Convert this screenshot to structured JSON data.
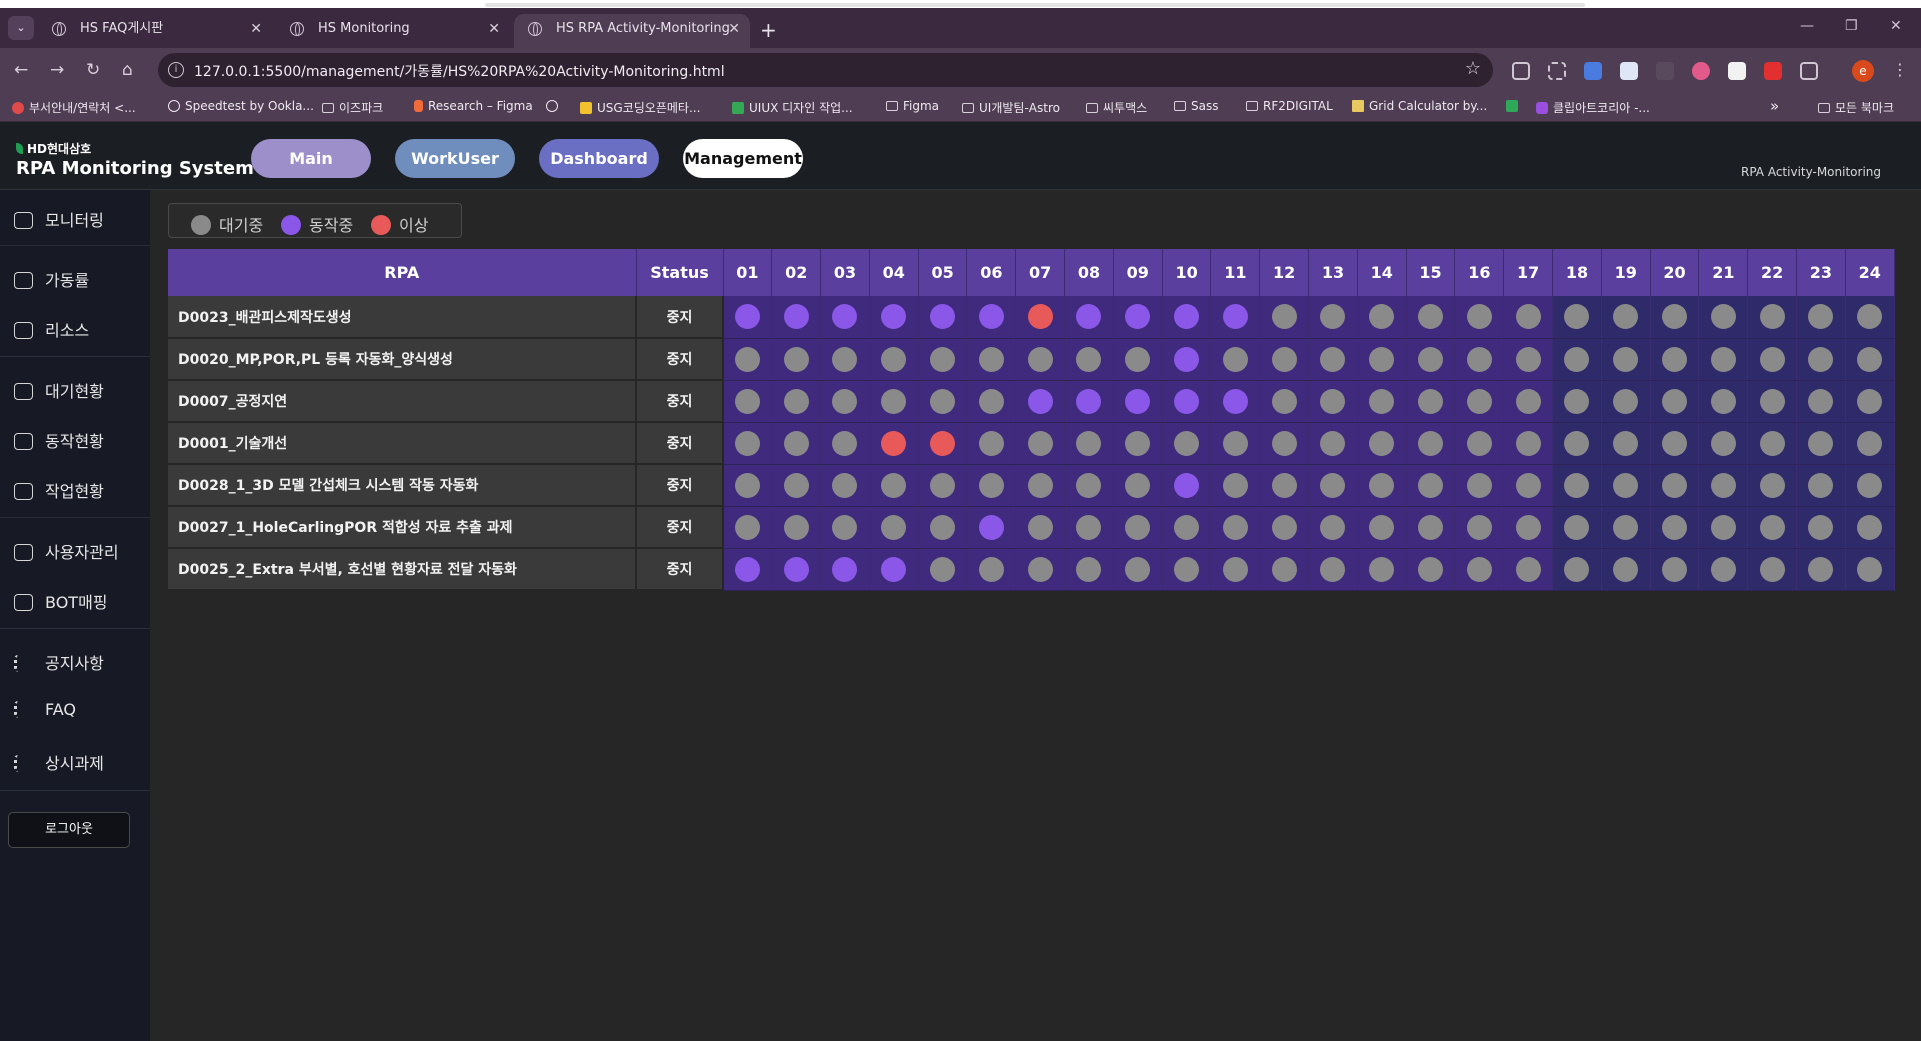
{
  "browser": {
    "tabs": [
      {
        "title": "HS FAQ게시판",
        "active": false
      },
      {
        "title": "HS Monitoring",
        "active": false
      },
      {
        "title": "HS RPA Activity-Monitoring",
        "active": true
      }
    ],
    "new_tab": "+",
    "url": "127.0.0.1:5500/management/가동률/HS%20RPA%20Activity-Monitoring.html",
    "profile_initial": "e",
    "bookmarks": [
      {
        "label": "부서안내/연락처 <...",
        "icon": "red-circle-icon"
      },
      {
        "label": "Speedtest by Ookla...",
        "icon": "speedtest-icon"
      },
      {
        "label": "이즈파크",
        "icon": "folder-icon"
      },
      {
        "label": "Research – Figma",
        "icon": "figma-icon"
      },
      {
        "label": "",
        "icon": "globe-icon"
      },
      {
        "label": "USG코딩오픈메타...",
        "icon": "drive-icon"
      },
      {
        "label": "UIUX 디자인 작업...",
        "icon": "drive-icon"
      },
      {
        "label": "Figma",
        "icon": "folder-icon"
      },
      {
        "label": "UI개발팀-Astro",
        "icon": "folder-icon"
      },
      {
        "label": "씨투맥스",
        "icon": "folder-icon"
      },
      {
        "label": "Sass",
        "icon": "folder-icon"
      },
      {
        "label": "RF2DIGITAL",
        "icon": "folder-icon"
      },
      {
        "label": "Grid Calculator by...",
        "icon": "grid-icon"
      },
      {
        "label": "",
        "icon": "w-icon"
      },
      {
        "label": "클립아트코리아 -...",
        "icon": "ck-icon"
      },
      {
        "label": "»",
        "icon": ""
      },
      {
        "label": "모든 북마크",
        "icon": "folder-icon"
      }
    ]
  },
  "header": {
    "company": "HD현대삼호",
    "brand": "RPA Monitoring System",
    "nav": [
      {
        "label": "Main",
        "color": "#9d8fc9"
      },
      {
        "label": "WorkUser",
        "color": "#6f8dbd"
      },
      {
        "label": "Dashboard",
        "color": "#6b6fc3"
      },
      {
        "label": "Management",
        "color": "#ffffff"
      }
    ],
    "page_label": "RPA Activity-Monitoring"
  },
  "sidebar": {
    "items": [
      {
        "label": "모니터링",
        "icon": "monitor-icon"
      },
      {
        "label": "가동률",
        "icon": "monitor-icon"
      },
      {
        "label": "리소스",
        "icon": "plus-box-icon"
      },
      {
        "label": "대기현황",
        "icon": "list-box-icon"
      },
      {
        "label": "동작현황",
        "icon": "chart-down-icon"
      },
      {
        "label": "작업현황",
        "icon": "bar-chart-icon"
      },
      {
        "label": "사용자관리",
        "icon": "user-monitor-icon"
      },
      {
        "label": "BOT매핑",
        "icon": "monitor-icon"
      },
      {
        "label": "공지사항",
        "icon": "list-icon"
      },
      {
        "label": "FAQ",
        "icon": "list-icon"
      },
      {
        "label": "상시과제",
        "icon": "list-icon"
      }
    ],
    "logout": "로그아웃"
  },
  "legend": [
    {
      "label": "대기중",
      "color": "#8a8a8a"
    },
    {
      "label": "동작중",
      "color": "#8b57e8"
    },
    {
      "label": "이상",
      "color": "#e85a5a"
    }
  ],
  "table": {
    "col_rpa": "RPA",
    "col_status": "Status",
    "hours": [
      "01",
      "02",
      "03",
      "04",
      "05",
      "06",
      "07",
      "08",
      "09",
      "10",
      "11",
      "12",
      "13",
      "14",
      "15",
      "16",
      "17",
      "18",
      "19",
      "20",
      "21",
      "22",
      "23",
      "24"
    ],
    "colors": {
      "idle": "#8a8a8a",
      "running": "#8b57e8",
      "error": "#e85a5a"
    },
    "rows": [
      {
        "name": "D0023_배관피스제작도생성",
        "status": "중지",
        "states": [
          "running",
          "running",
          "running",
          "running",
          "running",
          "running",
          "error",
          "running",
          "running",
          "running",
          "running",
          "idle",
          "idle",
          "idle",
          "idle",
          "idle",
          "idle",
          "idle",
          "idle",
          "idle",
          "idle",
          "idle",
          "idle",
          "idle"
        ]
      },
      {
        "name": "D0020_MP,POR,PL 등록 자동화_양식생성",
        "status": "중지",
        "states": [
          "idle",
          "idle",
          "idle",
          "idle",
          "idle",
          "idle",
          "idle",
          "idle",
          "idle",
          "running",
          "idle",
          "idle",
          "idle",
          "idle",
          "idle",
          "idle",
          "idle",
          "idle",
          "idle",
          "idle",
          "idle",
          "idle",
          "idle",
          "idle"
        ]
      },
      {
        "name": "D0007_공정지연",
        "status": "중지",
        "states": [
          "idle",
          "idle",
          "idle",
          "idle",
          "idle",
          "idle",
          "running",
          "running",
          "running",
          "running",
          "running",
          "idle",
          "idle",
          "idle",
          "idle",
          "idle",
          "idle",
          "idle",
          "idle",
          "idle",
          "idle",
          "idle",
          "idle",
          "idle"
        ]
      },
      {
        "name": "D0001_기술개선",
        "status": "중지",
        "states": [
          "idle",
          "idle",
          "idle",
          "error",
          "error",
          "idle",
          "idle",
          "idle",
          "idle",
          "idle",
          "idle",
          "idle",
          "idle",
          "idle",
          "idle",
          "idle",
          "idle",
          "idle",
          "idle",
          "idle",
          "idle",
          "idle",
          "idle",
          "idle"
        ]
      },
      {
        "name": "D0028_1_3D 모델 간섭체크 시스템 작동 자동화",
        "status": "중지",
        "states": [
          "idle",
          "idle",
          "idle",
          "idle",
          "idle",
          "idle",
          "idle",
          "idle",
          "idle",
          "running",
          "idle",
          "idle",
          "idle",
          "idle",
          "idle",
          "idle",
          "idle",
          "idle",
          "idle",
          "idle",
          "idle",
          "idle",
          "idle",
          "idle"
        ]
      },
      {
        "name": "D0027_1_HoleCarlingPOR 적합성 자료 추출 과제",
        "status": "중지",
        "states": [
          "idle",
          "idle",
          "idle",
          "idle",
          "idle",
          "running",
          "idle",
          "idle",
          "idle",
          "idle",
          "idle",
          "idle",
          "idle",
          "idle",
          "idle",
          "idle",
          "idle",
          "idle",
          "idle",
          "idle",
          "idle",
          "idle",
          "idle",
          "idle"
        ]
      },
      {
        "name": "D0025_2_Extra 부서별, 호선별 현황자료 전달 자동화",
        "status": "중지",
        "states": [
          "running",
          "running",
          "running",
          "running",
          "idle",
          "idle",
          "idle",
          "idle",
          "idle",
          "idle",
          "idle",
          "idle",
          "idle",
          "idle",
          "idle",
          "idle",
          "idle",
          "idle",
          "idle",
          "idle",
          "idle",
          "idle",
          "idle",
          "idle"
        ]
      }
    ]
  }
}
